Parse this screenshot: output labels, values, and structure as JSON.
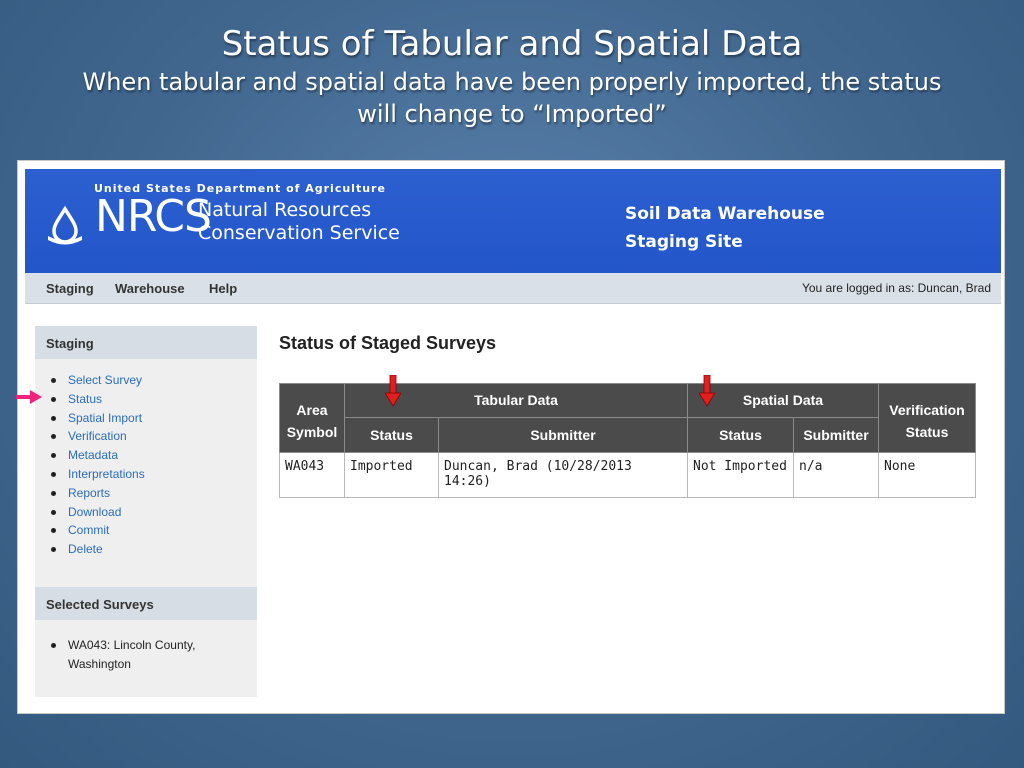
{
  "slide": {
    "title": "Status of Tabular and Spatial Data",
    "subtitle": "When tabular and spatial data have been properly imported, the status will change to “Imported”"
  },
  "header": {
    "usda": "United States Department of Agriculture",
    "logo_text": "NRCS",
    "agency_line1": "Natural Resources",
    "agency_line2": "Conservation Service",
    "site_line1": "Soil Data Warehouse",
    "site_line2": "Staging Site"
  },
  "nav": {
    "items": [
      "Staging",
      "Warehouse",
      "Help"
    ],
    "logged_in": "You are logged in as: Duncan, Brad"
  },
  "sidebar": {
    "staging_heading": "Staging",
    "links": [
      "Select Survey",
      "Status",
      "Spatial Import",
      "Verification",
      "Metadata",
      "Interpretations",
      "Reports",
      "Download",
      "Commit",
      "Delete"
    ],
    "selected_heading": "Selected Surveys",
    "selected_items": [
      "WA043: Lincoln County, Washington"
    ]
  },
  "main": {
    "title": "Status of Staged Surveys",
    "table": {
      "area_symbol_header": "Area Symbol",
      "tabular_header": "Tabular Data",
      "spatial_header": "Spatial Data",
      "verification_header": "Verification Status",
      "sub_headers": [
        "Status",
        "Submitter",
        "Status",
        "Submitter"
      ],
      "rows": [
        [
          "WA043",
          "Imported",
          "Duncan, Brad (10/28/2013 14:26)",
          "Not Imported",
          "n/a",
          "None"
        ]
      ]
    }
  },
  "colors": {
    "banner": "#2356c9",
    "link": "#2a6db8",
    "table_header": "#4b4b4b",
    "annotation_red": "#e02020",
    "annotation_pink": "#f0227a"
  }
}
